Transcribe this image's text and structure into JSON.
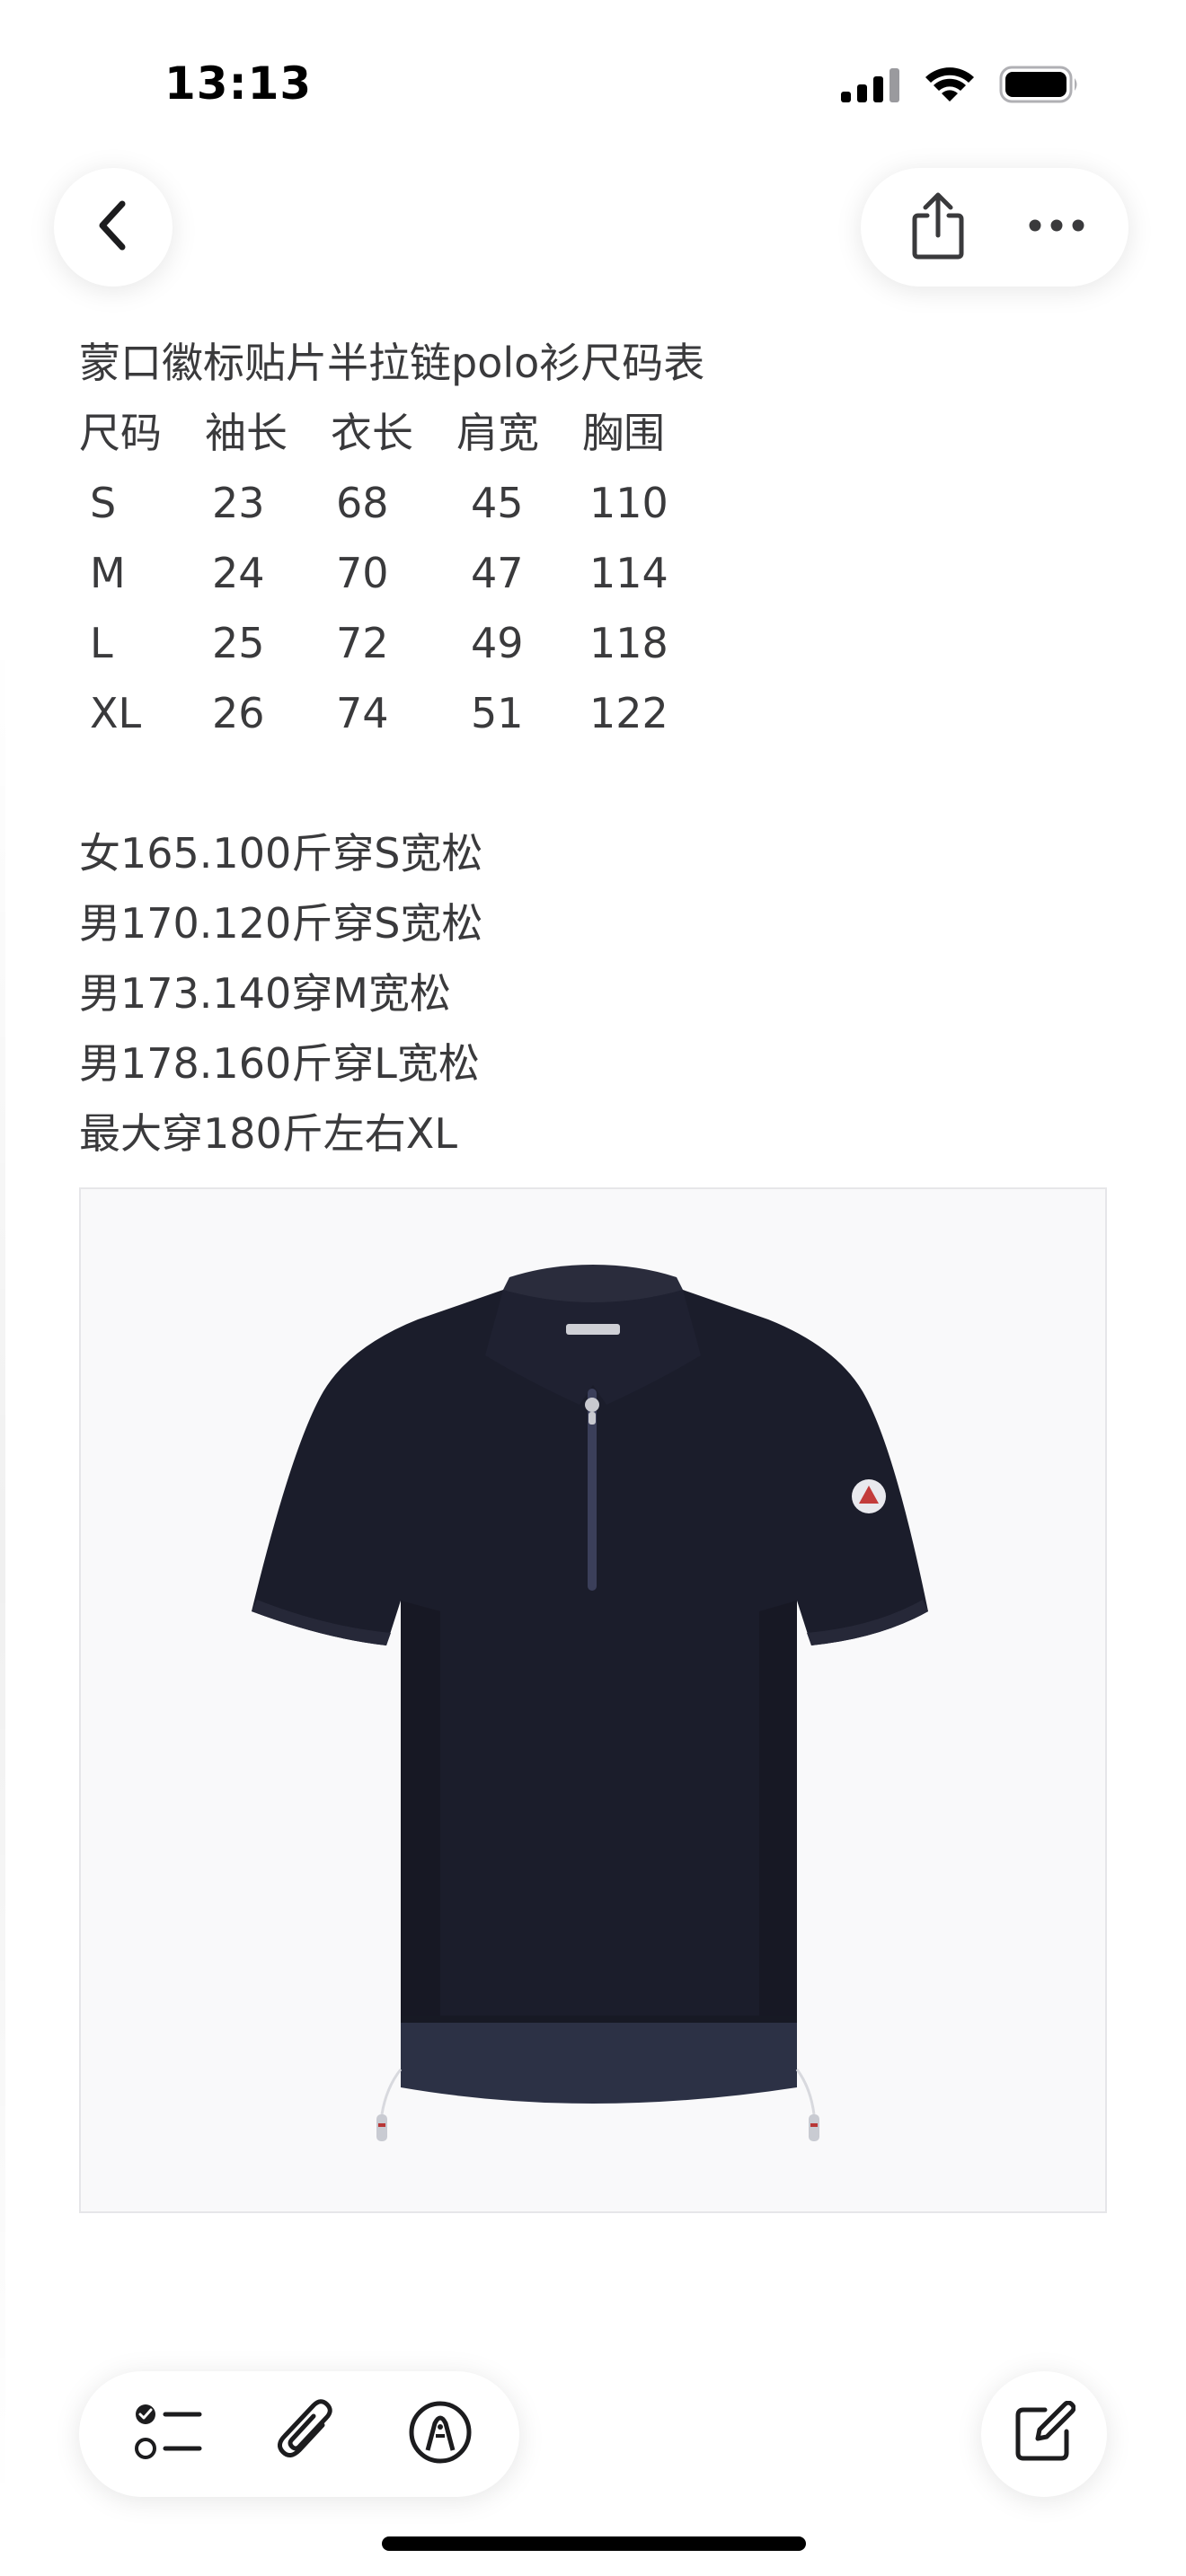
{
  "status_bar": {
    "time": "13:13",
    "icons": [
      "cellular-signal-icon",
      "wifi-icon",
      "battery-icon"
    ]
  },
  "navigation": {
    "back_icon": "chevron-left-icon",
    "share_icon": "share-icon",
    "more_icon": "ellipsis-icon"
  },
  "note": {
    "title": "蒙口徽标贴片半拉链polo衫尺码表",
    "size_table": {
      "headers": [
        "尺码",
        "袖长",
        "衣长",
        "肩宽",
        "胸围"
      ],
      "rows": [
        [
          "S",
          "23",
          "68",
          "45",
          "110"
        ],
        [
          "M",
          "24",
          "70",
          "47",
          "114"
        ],
        [
          "L",
          "25",
          "72",
          "49",
          "118"
        ],
        [
          "XL",
          "26",
          "74",
          "51",
          "122"
        ]
      ]
    },
    "fit_guide": [
      "女165.100斤穿S宽松",
      "男170.120斤穿S宽松",
      "男173.140穿M宽松",
      "男178.160斤穿L宽松",
      "最大穿180斤左右XL"
    ]
  },
  "image": {
    "subject": "navy-zip-polo-shirt",
    "shirt_color": "#1b1d2b",
    "hem_color": "#2c3145",
    "background": "#f9f9fa"
  },
  "toolbar": {
    "icons": [
      "checklist-icon",
      "paperclip-icon",
      "markup-pen-icon"
    ],
    "compose_icon": "compose-icon"
  }
}
